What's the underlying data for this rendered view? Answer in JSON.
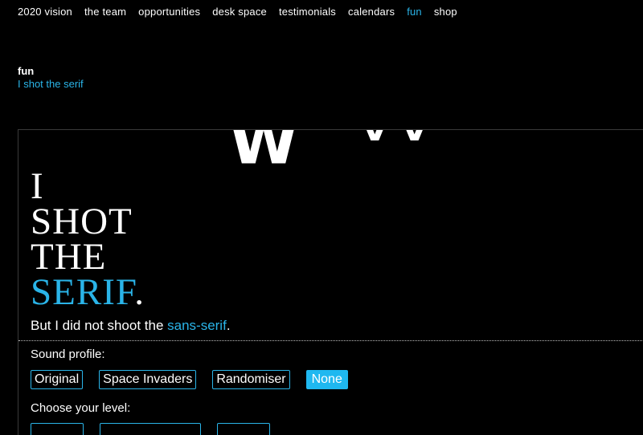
{
  "nav": {
    "items": [
      "2020 vision",
      "the team",
      "opportunities",
      "desk space",
      "testimonials",
      "calendars",
      "fun",
      "shop"
    ],
    "active": "fun"
  },
  "breadcrumb": {
    "section": "fun",
    "page": "I shot the serif"
  },
  "game": {
    "title_lines": [
      "I",
      "SHOT",
      "THE"
    ],
    "title_highlight": "SERIF",
    "title_dot": ".",
    "tagline_prefix": "But I did not shoot the ",
    "tagline_highlight": "sans-serif",
    "tagline_suffix": ".",
    "invader_glyphs": [
      "W",
      "V V"
    ],
    "sound": {
      "label": "Sound profile:",
      "options": [
        "Original",
        "Space Invaders",
        "Randomiser",
        "None"
      ],
      "selected": "None"
    },
    "level": {
      "label": "Choose your level:"
    }
  },
  "colors": {
    "accent": "#2ab4e8",
    "background": "#000000",
    "text": "#ffffff"
  }
}
